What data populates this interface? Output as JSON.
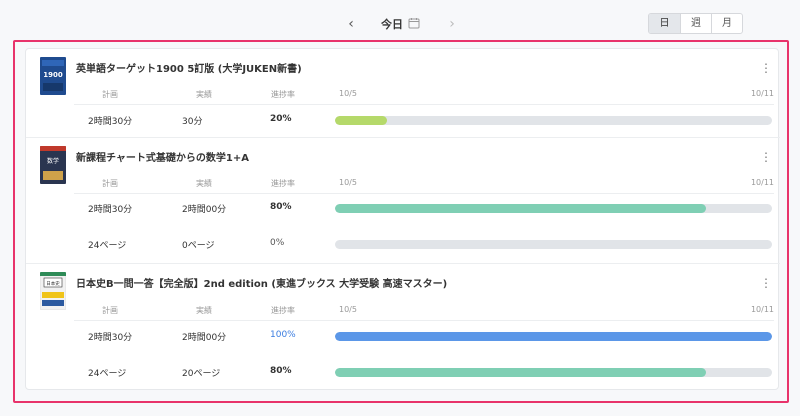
{
  "nav": {
    "prev": "‹",
    "date": "今日",
    "next": "›"
  },
  "view_tabs": [
    {
      "label": "日",
      "active": true
    },
    {
      "label": "週",
      "active": false
    },
    {
      "label": "月",
      "active": false
    }
  ],
  "headers": {
    "plan": "計画",
    "actual": "実績",
    "rate": "進捗率"
  },
  "books": [
    {
      "title": "英単語ターゲット1900 5訂版 (大学JUKEN新書)",
      "cover_text": "1900",
      "cover_color": "#1f4b8f",
      "start_date": "10/5",
      "end_date": "10/11",
      "rows": [
        {
          "plan": "2時間30分",
          "actual": "30分",
          "rate": "20%",
          "progress": 0.12,
          "color": "#b5d96a"
        }
      ]
    },
    {
      "title": "新課程チャート式基礎からの数学1+A",
      "cover_text": "数学",
      "cover_color": "#2a3550",
      "start_date": "10/5",
      "end_date": "10/11",
      "rows": [
        {
          "plan": "2時間30分",
          "actual": "2時間00分",
          "rate": "80%",
          "progress": 0.85,
          "color": "#7fcfb4"
        },
        {
          "plan": "24ページ",
          "actual": "0ページ",
          "rate": "0%",
          "progress": 0,
          "color": "#7fcfb4"
        }
      ]
    },
    {
      "title": "日本史B一問一答【完全版】2nd edition (東進ブックス 大学受験 高速マスター)",
      "cover_text": "日本史",
      "cover_color": "#f2f2f2",
      "start_date": "10/5",
      "end_date": "10/11",
      "rows": [
        {
          "plan": "2時間30分",
          "actual": "2時間00分",
          "rate": "100%",
          "progress": 1.0,
          "color": "#5b97e8"
        },
        {
          "plan": "24ページ",
          "actual": "20ページ",
          "rate": "80%",
          "progress": 0.85,
          "color": "#7fcfb4"
        }
      ]
    }
  ]
}
